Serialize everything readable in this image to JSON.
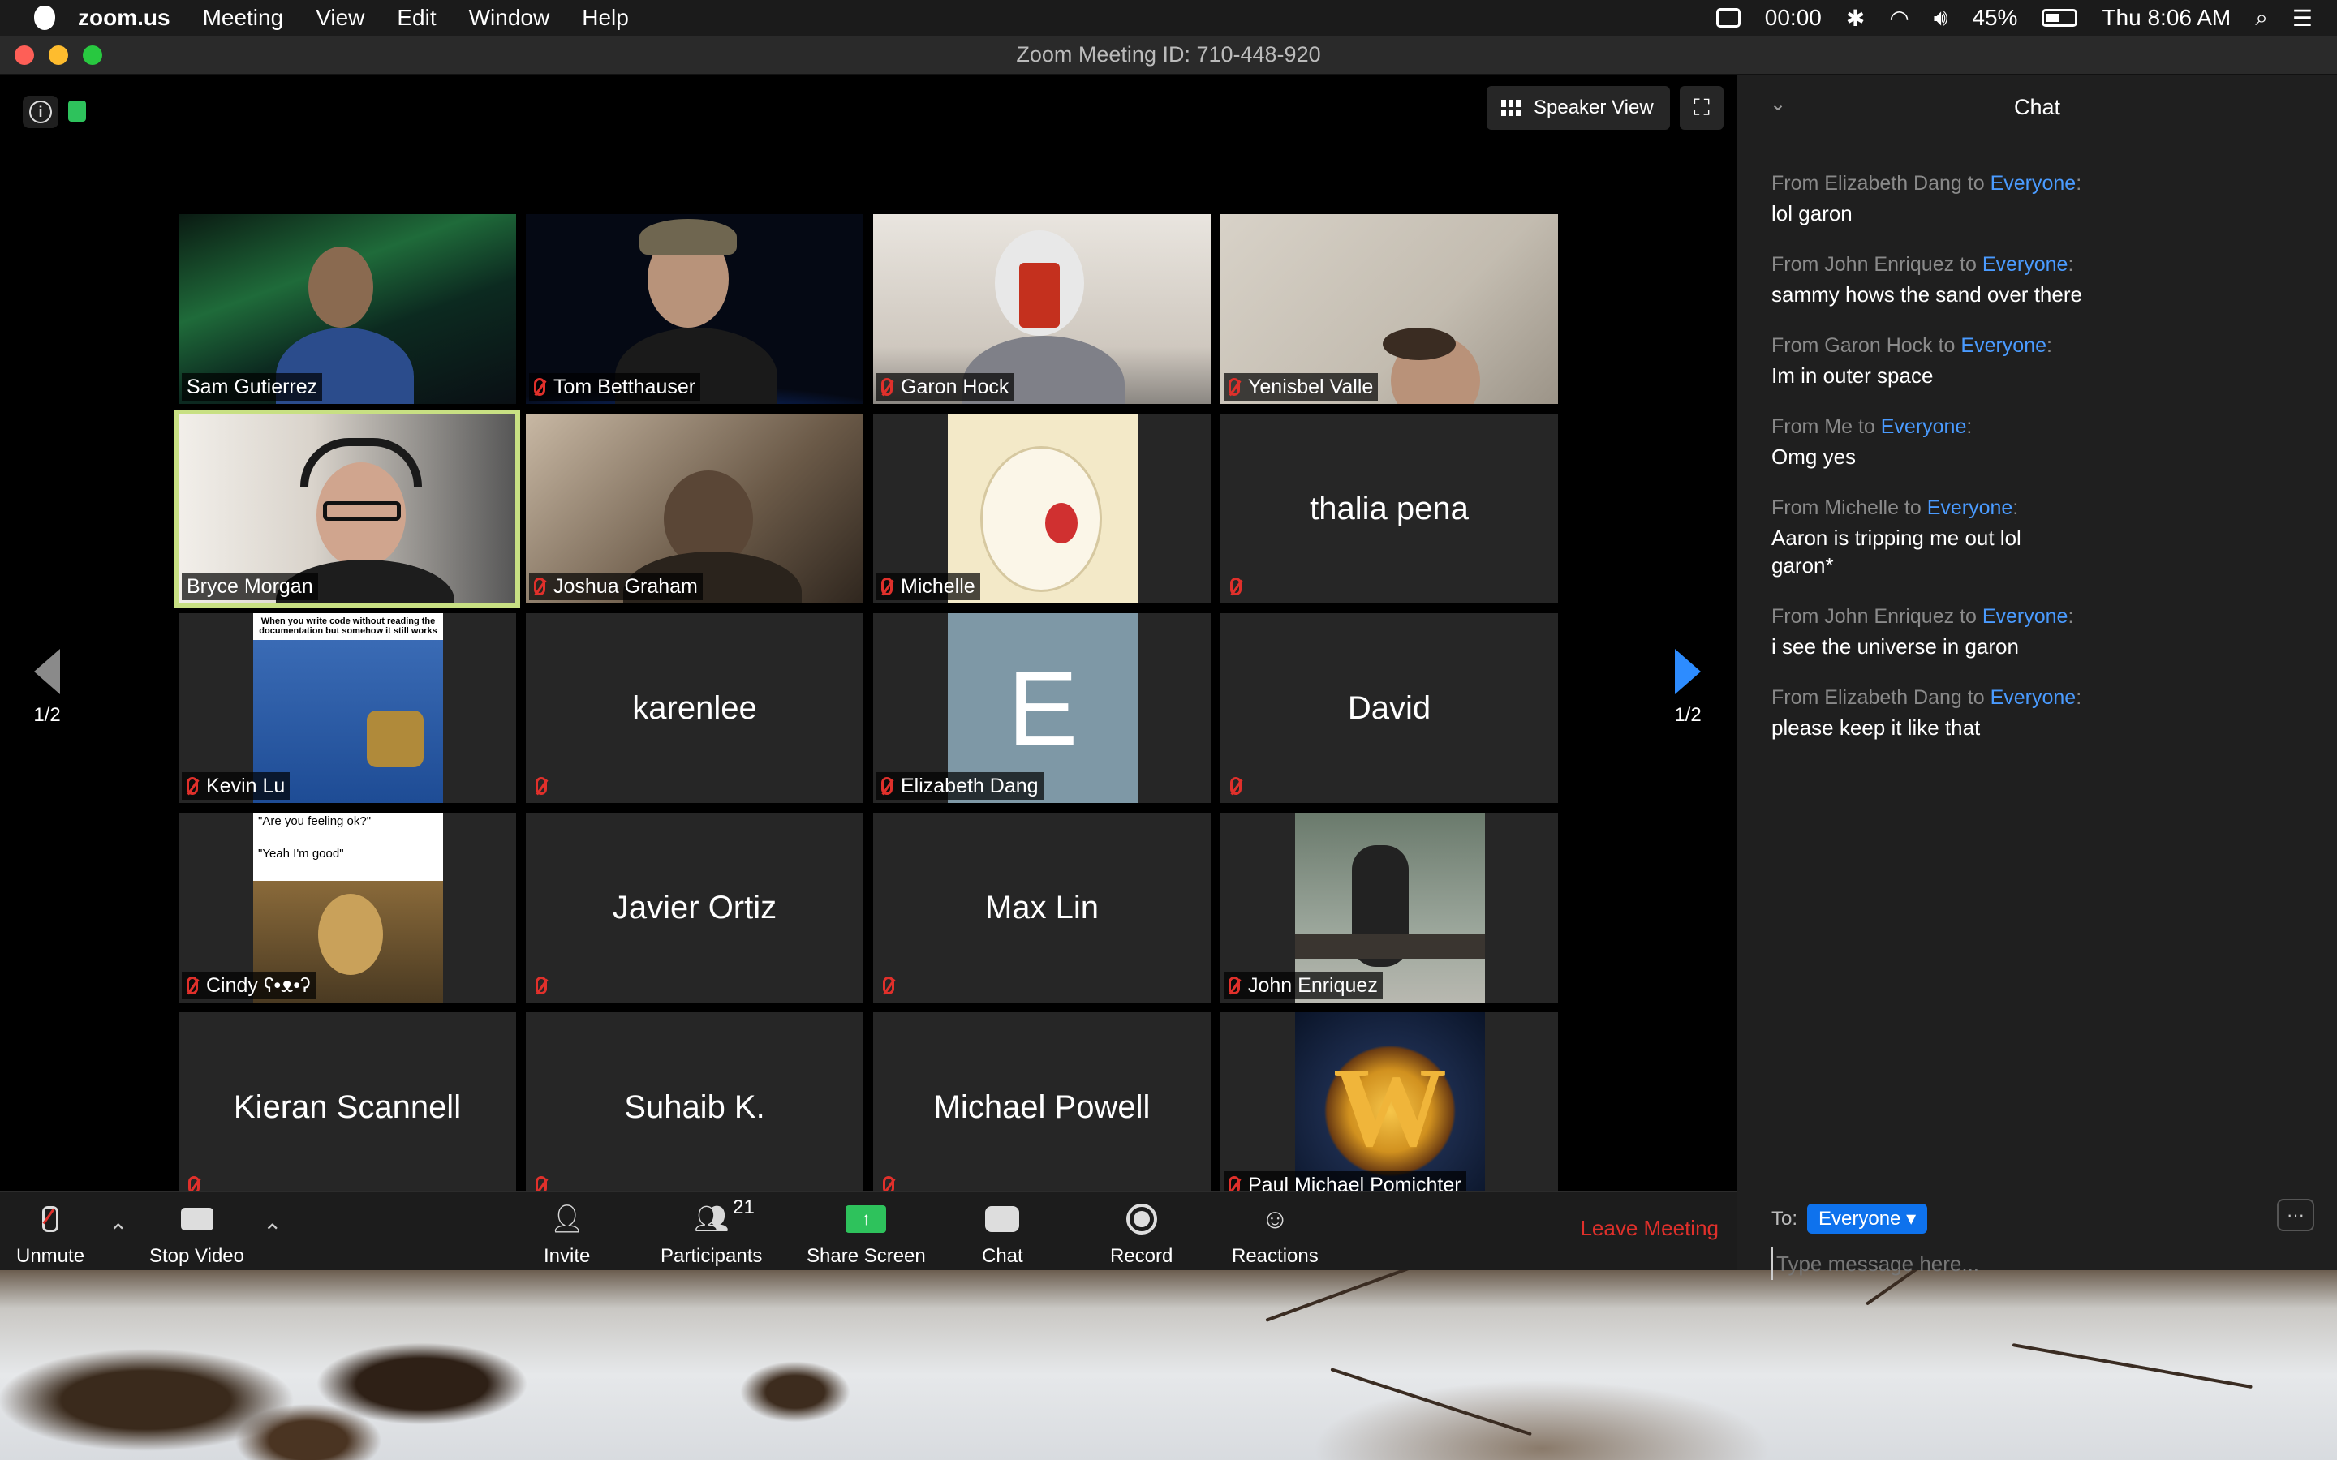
{
  "menubar": {
    "app_name": "zoom.us",
    "menus": [
      "Meeting",
      "View",
      "Edit",
      "Window",
      "Help"
    ],
    "recording_time": "00:00",
    "battery": "45%",
    "clock": "Thu 8:06 AM"
  },
  "window": {
    "title": "Zoom Meeting ID: 710-448-920"
  },
  "stage": {
    "view_button": "Speaker View",
    "page_left": "1/2",
    "page_right": "1/2"
  },
  "participants": [
    {
      "name": "Sam Gutierrez",
      "muted": false
    },
    {
      "name": "Tom Betthauser",
      "muted": true
    },
    {
      "name": "Garon Hock",
      "muted": true
    },
    {
      "name": "Yenisbel Valle",
      "muted": true
    },
    {
      "name": "Bryce Morgan",
      "muted": false,
      "active_speaker": true
    },
    {
      "name": "Joshua Graham",
      "muted": true
    },
    {
      "name": "Michelle",
      "muted": true
    },
    {
      "name": "thalia pena",
      "muted": true,
      "video_off": true
    },
    {
      "name": "Kevin Lu",
      "muted": true
    },
    {
      "name": "karenlee",
      "muted": true,
      "video_off": true
    },
    {
      "name": "Elizabeth Dang",
      "muted": true,
      "avatar_letter": "E"
    },
    {
      "name": "David",
      "muted": true,
      "video_off": true
    },
    {
      "name": "Cindy ʕ•ᴥ•ʔ",
      "muted": true
    },
    {
      "name": "Javier Ortiz",
      "muted": true,
      "video_off": true
    },
    {
      "name": "Max Lin",
      "muted": true,
      "video_off": true
    },
    {
      "name": "John Enriquez",
      "muted": true
    },
    {
      "name": "Kieran Scannell",
      "muted": true,
      "video_off": true
    },
    {
      "name": "Suhaib K.",
      "muted": true,
      "video_off": true
    },
    {
      "name": "Michael Powell",
      "muted": true,
      "video_off": true
    },
    {
      "name": "Paul Michael Pomichter",
      "muted": true
    }
  ],
  "tile_images": {
    "meme_caption": "When you write code without reading the documentation but somehow it still works",
    "mona_line1": "\"Are you feeling ok?\"",
    "mona_line2": "\"Yeah I'm good\""
  },
  "toolbar": {
    "unmute": "Unmute",
    "stop_video": "Stop Video",
    "invite": "Invite",
    "participants": "Participants",
    "participants_count": "21",
    "share_screen": "Share Screen",
    "chat": "Chat",
    "record": "Record",
    "reactions": "Reactions",
    "leave": "Leave Meeting"
  },
  "chat": {
    "title": "Chat",
    "messages": [
      {
        "from": "From Elizabeth Dang to ",
        "to": "Everyone",
        "text": "lol garon"
      },
      {
        "from": "From John Enriquez to ",
        "to": "Everyone",
        "text": "sammy hows the sand over there"
      },
      {
        "from": "From Garon Hock to ",
        "to": "Everyone",
        "text": "Im in outer space"
      },
      {
        "from": "From Me to ",
        "to": "Everyone",
        "text": "Omg yes"
      },
      {
        "from": "From Michelle to ",
        "to": "Everyone",
        "text": "Aaron is tripping me out lol garon*"
      },
      {
        "from": "From John Enriquez to ",
        "to": "Everyone",
        "text": "i see the universe in garon"
      },
      {
        "from": "From Elizabeth Dang to ",
        "to": "Everyone",
        "text": "please keep it like that"
      }
    ],
    "to_label": "To:",
    "to_value": "Everyone",
    "more": "···",
    "input_placeholder": "Type message here..."
  },
  "colors": {
    "accent": "#2d8cff",
    "mute_red": "#e0302b",
    "active_speaker_border": "#c8e083",
    "share_green": "#2ec25c"
  }
}
